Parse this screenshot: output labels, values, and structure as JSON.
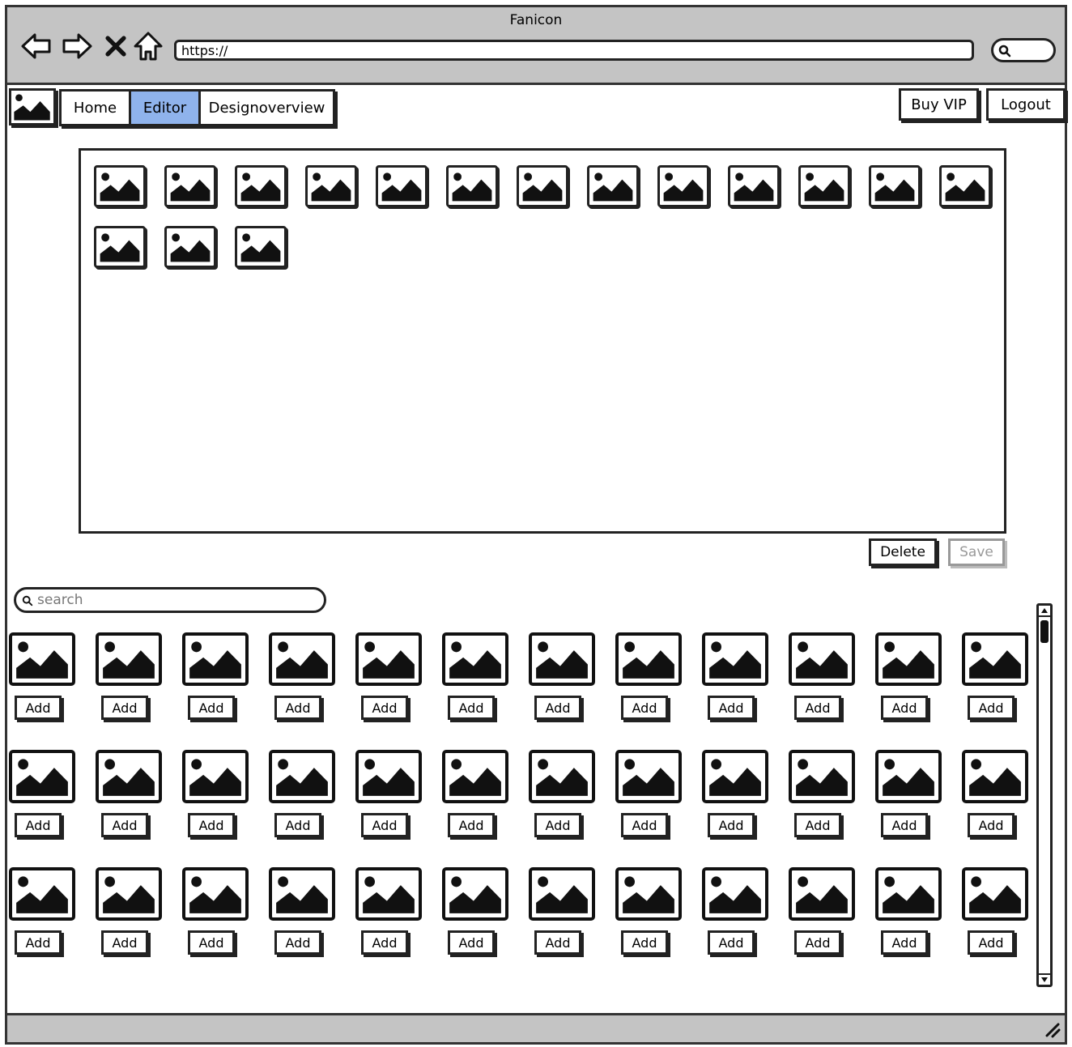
{
  "window": {
    "title": "Fanicon"
  },
  "browser": {
    "url": "https://",
    "nav": [
      "back-arrow-icon",
      "forward-arrow-icon",
      "stop-icon",
      "home-icon"
    ]
  },
  "navbar": {
    "tabs": [
      {
        "label": "Home",
        "active": false
      },
      {
        "label": "Editor",
        "active": true
      },
      {
        "label": "Designoverview",
        "active": false
      }
    ],
    "buy_vip_label": "Buy VIP",
    "logout_label": "Logout"
  },
  "editor": {
    "placed_image_count": 16,
    "delete_label": "Delete",
    "save_label": "Save",
    "save_enabled": false
  },
  "library": {
    "search_placeholder": "search",
    "rows": 3,
    "columns": 12,
    "add_label": "Add"
  },
  "colors": {
    "chrome": "#c4c4c4",
    "active_tab": "#8fb3ec",
    "disabled": "#999999"
  }
}
